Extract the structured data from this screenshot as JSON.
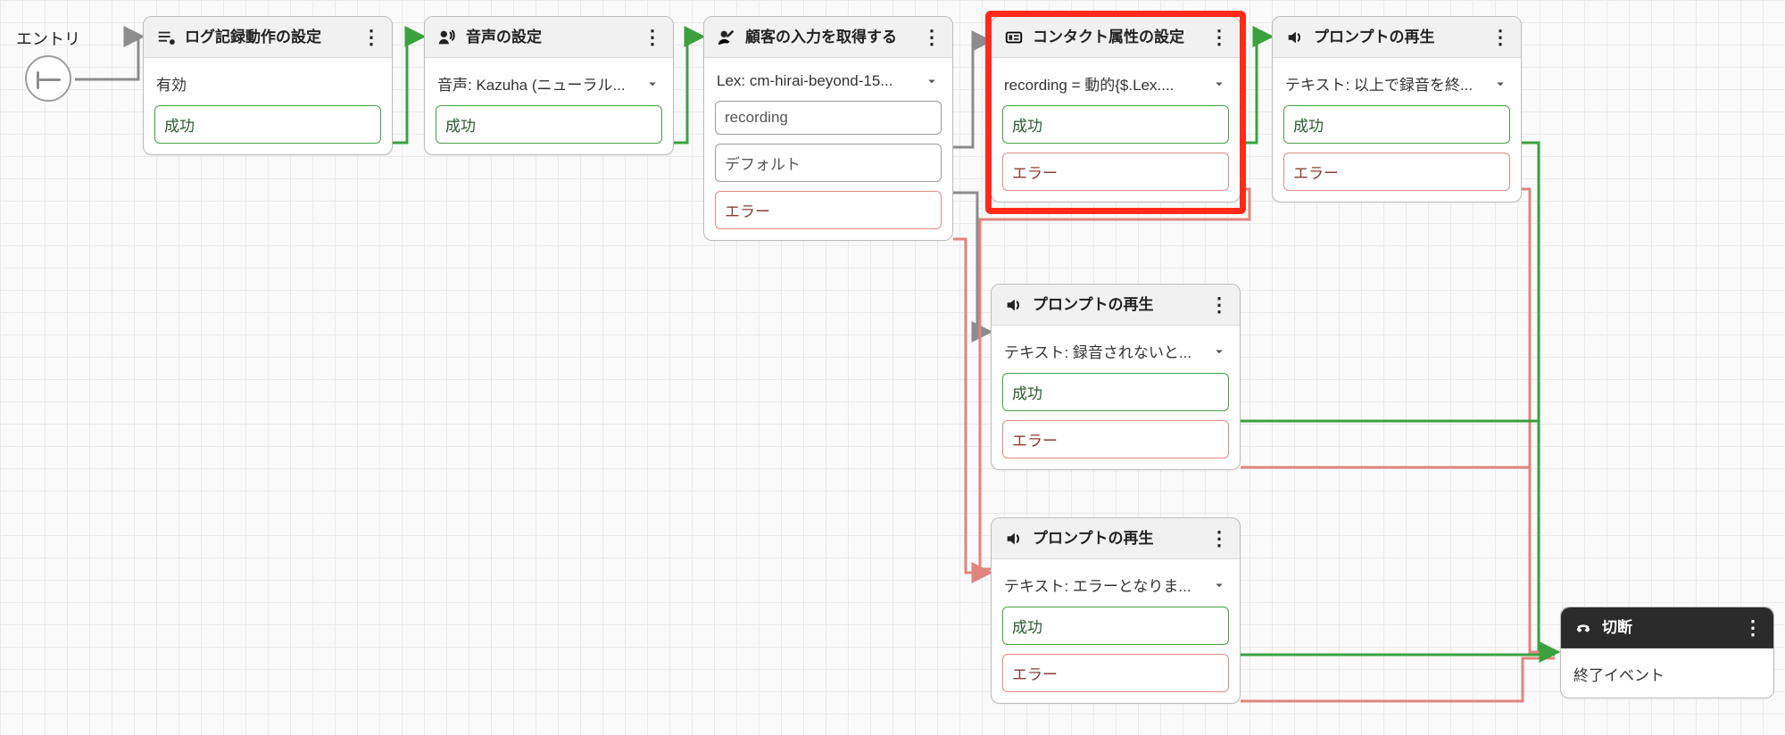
{
  "entry": {
    "label": "エントリ"
  },
  "nodes": {
    "log": {
      "title": "ログ記録動作の設定",
      "body": "有効",
      "out1": "成功"
    },
    "voice": {
      "title": "音声の設定",
      "body": "音声: Kazuha (ニューラル...",
      "out1": "成功"
    },
    "input": {
      "title": "顧客の入力を取得する",
      "body": "Lex: cm-hirai-beyond-15...",
      "out1": "recording",
      "out2": "デフォルト",
      "out3": "エラー"
    },
    "attr": {
      "title": "コンタクト属性の設定",
      "body": "recording = 動的{$.Lex....",
      "out1": "成功",
      "out2": "エラー"
    },
    "play1": {
      "title": "プロンプトの再生",
      "body": "テキスト: 以上で録音を終...",
      "out1": "成功",
      "out2": "エラー"
    },
    "play2": {
      "title": "プロンプトの再生",
      "body": "テキスト: 録音されないと...",
      "out1": "成功",
      "out2": "エラー"
    },
    "play3": {
      "title": "プロンプトの再生",
      "body": "テキスト: エラーとなりま...",
      "out1": "成功",
      "out2": "エラー"
    },
    "disc": {
      "title": "切断",
      "body": "終了イベント"
    }
  },
  "colors": {
    "neutralEdge": "#8c8c8c",
    "successEdge": "#3aa13d",
    "errorEdge": "#df857d"
  }
}
